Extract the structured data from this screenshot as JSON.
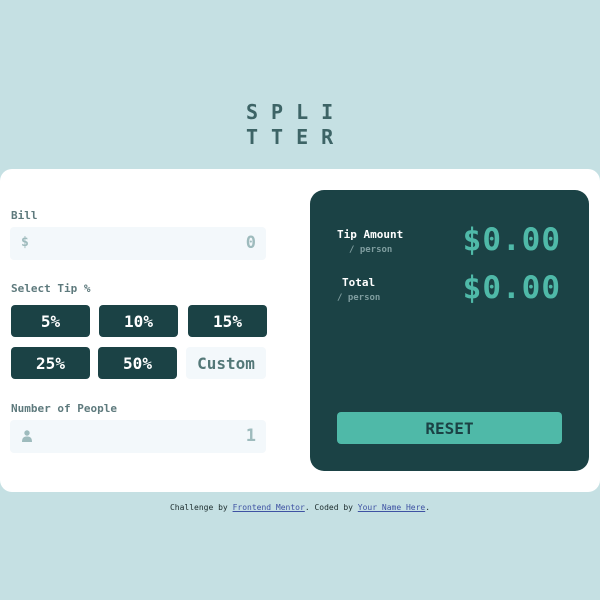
{
  "logo": {
    "line1": "SPLI",
    "line2": "TTER"
  },
  "bill": {
    "label": "Bill",
    "currency_icon": "dollar-sign",
    "value": "0"
  },
  "tip": {
    "label": "Select Tip %",
    "options": [
      "5%",
      "10%",
      "15%",
      "25%",
      "50%"
    ],
    "custom_placeholder": "Custom"
  },
  "people": {
    "label": "Number of People",
    "icon": "person-icon",
    "value": "1"
  },
  "results": {
    "tip_amount_label": "Tip Amount",
    "tip_amount_sub": "/ person",
    "tip_amount_value": "$0.00",
    "total_label": "Total",
    "total_sub": "/ person",
    "total_value": "$0.00",
    "reset_label": "RESET"
  },
  "footer": {
    "prefix": "Challenge by ",
    "link1": "Frontend Mentor",
    "middle": ". Coded by ",
    "link2": "Your Name Here",
    "suffix": "."
  },
  "colors": {
    "background": "#c5e0e3",
    "dark_teal": "#1b4245",
    "accent": "#4fb9a8",
    "input_bg": "#f3f8fb"
  }
}
